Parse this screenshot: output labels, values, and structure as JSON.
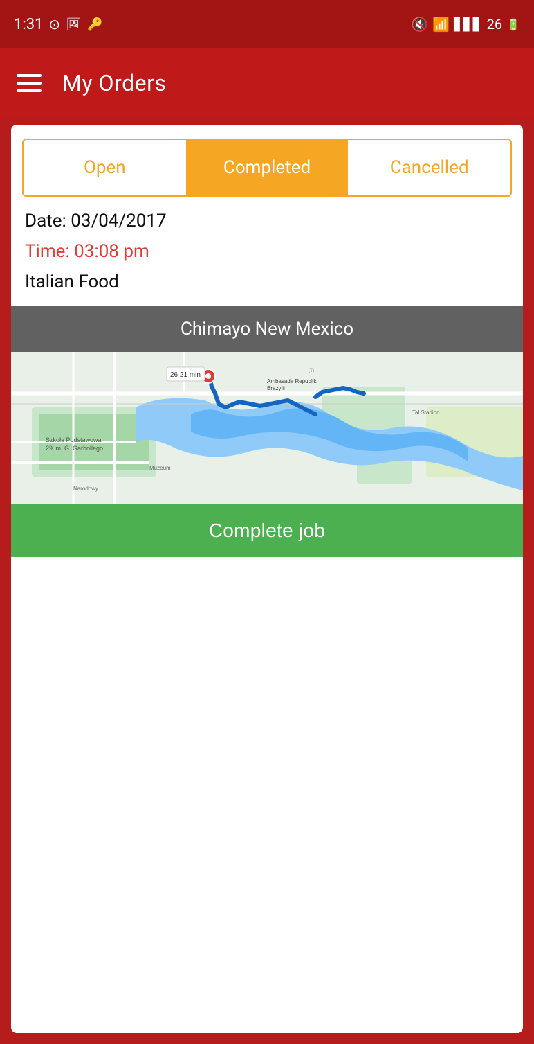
{
  "statusBar": {
    "time": "1:31",
    "battery": "26",
    "icons": [
      "notification",
      "photo",
      "key"
    ]
  },
  "appBar": {
    "title": "My Orders"
  },
  "tabs": [
    {
      "id": "open",
      "label": "Open",
      "active": false
    },
    {
      "id": "completed",
      "label": "Completed",
      "active": true
    },
    {
      "id": "cancelled",
      "label": "Cancelled",
      "active": false
    }
  ],
  "order": {
    "date_label": "Date: 03/04/2017",
    "time_label": "Time: 03:08 pm",
    "food_label": "Italian Food",
    "location": "Chimayo New Mexico",
    "complete_job_btn": "Complete job"
  }
}
